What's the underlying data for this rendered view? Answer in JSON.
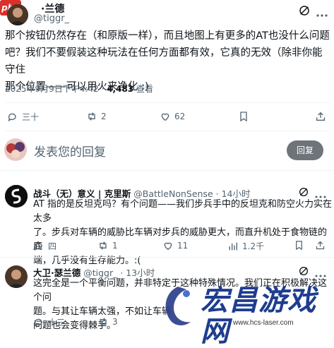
{
  "header": {
    "php_badge": "php",
    "display_name": "·兰德",
    "handle": "@tiggr_",
    "more_icon": "more-dots-icon",
    "grok_icon": "grok-icon"
  },
  "main_tweet": {
    "lines": [
      "那个按钮仍然存在（和原版一样），而且地图上有更多的AT也没什么问题",
      "吧？我们不要假装这种玩法在任何方面都有效，它真的无效（除非你能守住",
      "那个位置——可以用火来净化 :)"
    ],
    "timestamp": "2025年9月9日下午4:42 · ",
    "views_count": "4,483",
    "views_label": " 查看",
    "stats": {
      "replies": "三十",
      "reposts": "2",
      "likes": "62"
    }
  },
  "compose": {
    "placeholder": "发表您的回复",
    "reply_button": "回复"
  },
  "replies": [
    {
      "name": "战斗（无）意义 | 克里斯",
      "handle": "@BattleNonSense",
      "time": " · 14小时",
      "lines": [
        "AT 指的是反坦克吗？有个问题——我们步兵手中的反坦克和防空火力实在太多",
        "了。步兵对车辆的威胁比车辆对步兵的威胁更大，而直升机处于食物链的底",
        "端，几乎没有生存能力。:("
      ],
      "stats": {
        "replies": "四",
        "reposts": "1",
        "likes": "11",
        "views": "1.2千"
      }
    },
    {
      "name": "大卫·瑟兰德",
      "handle": "@tiggr_",
      "time": " · 13小时",
      "lines": [
        "这完全是一个平衡问题，并非特定于这种特殊情况。我们正在积极解决这个问",
        "题。与其让车辆太强，不如让车辆",
        "问题也会变得棘手。"
      ],
      "stats": {
        "replies": "十三",
        "reposts": "3",
        "likes": "",
        "views": ""
      }
    }
  ],
  "watermark": {
    "title": "宏昌游戏网",
    "url": "www.hcs-laser.com"
  },
  "colors": {
    "text": "#0f1419",
    "muted": "#536471",
    "divider": "#eff3f4",
    "reply_button_bg": "#6e7479",
    "php_badge_bg": "#d9302b",
    "watermark_blue": "#1f3d8f"
  }
}
